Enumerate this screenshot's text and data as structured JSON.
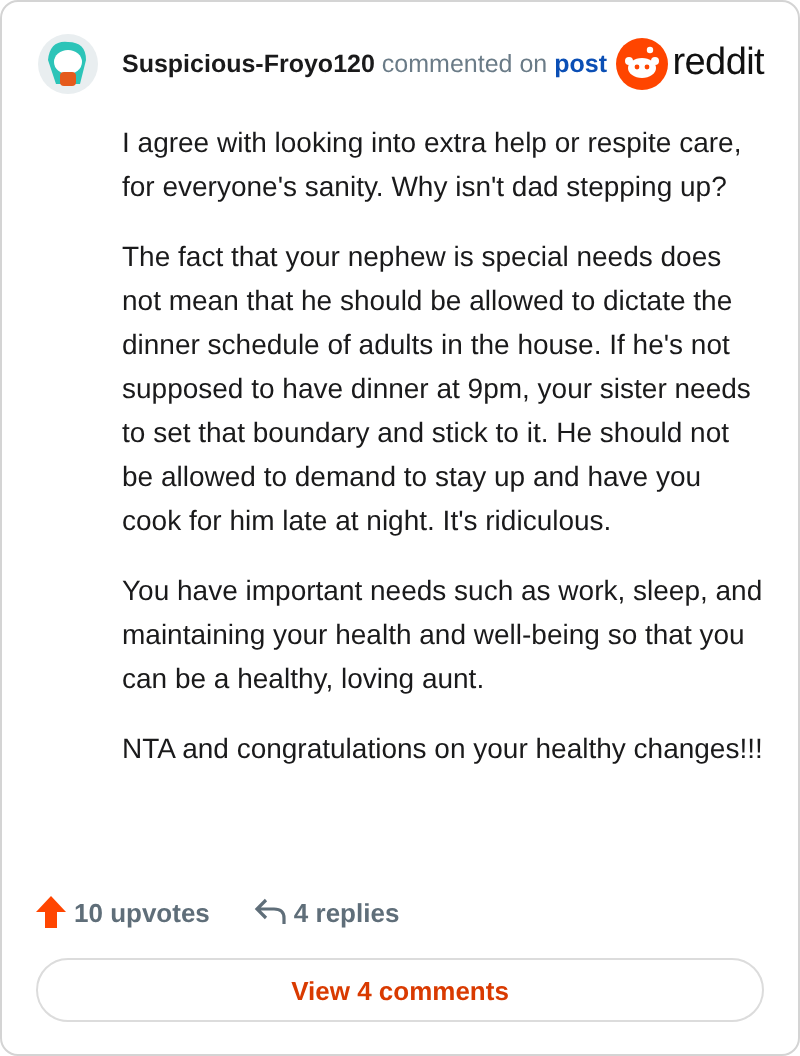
{
  "header": {
    "username": "Suspicious-Froyo120",
    "action": "commented on",
    "link": "post",
    "brand": "reddit"
  },
  "paragraphs": [
    "I agree with looking into extra help or respite care, for everyone's sanity. Why isn't dad stepping up?",
    "The fact that your nephew is special needs does not mean that he should be allowed to dictate the dinner schedule of adults in the house. If he's not supposed to have dinner at 9pm, your sister needs to set that boundary and stick to it. He should not be allowed to demand to stay up and have you cook for him late at night. It's ridiculous.",
    "You have important needs such as work, sleep, and maintaining your health and well-being so that you can be a healthy, loving aunt.",
    "NTA and congratulations on your healthy changes!!!"
  ],
  "footer": {
    "upvotes": "10 upvotes",
    "replies": "4 replies",
    "button": "View 4 comments"
  }
}
